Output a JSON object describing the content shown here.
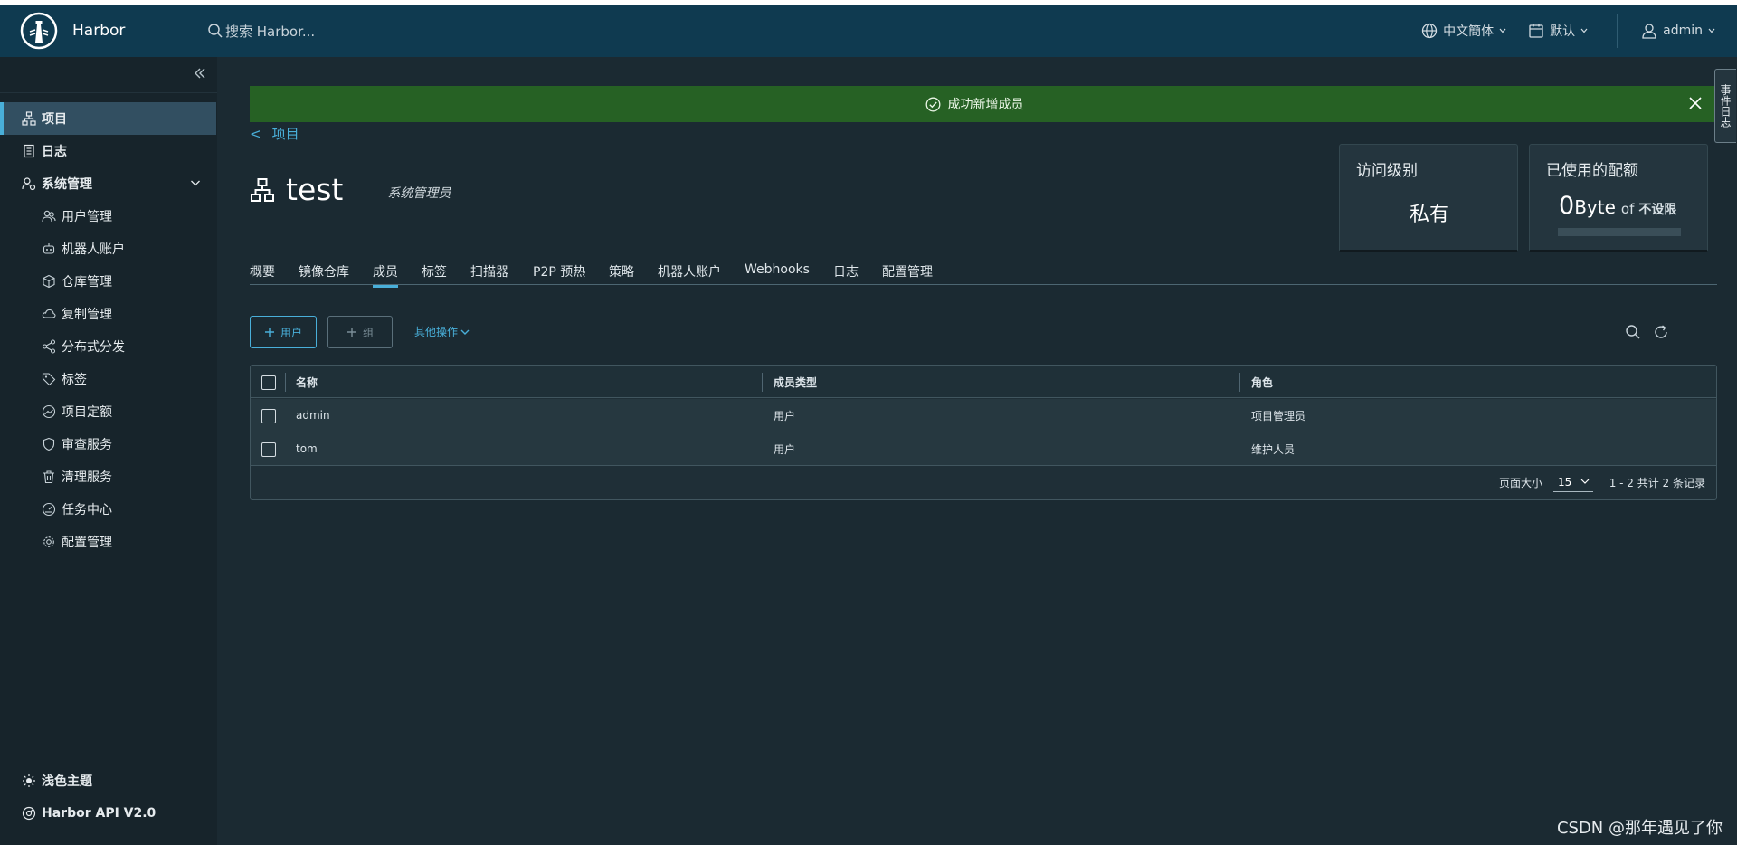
{
  "header": {
    "app_name": "Harbor",
    "search_placeholder": "搜索 Harbor...",
    "language": "中文簡体",
    "theme_mode": "默认",
    "user": "admin"
  },
  "sidebar": {
    "items": [
      {
        "label": "项目",
        "icon": "projects-icon",
        "level": "top",
        "active": true
      },
      {
        "label": "日志",
        "icon": "logs-icon",
        "level": "top"
      },
      {
        "label": "系统管理",
        "icon": "admin-icon",
        "level": "top",
        "expanded": true
      },
      {
        "label": "用户管理",
        "icon": "users-icon",
        "level": "sub"
      },
      {
        "label": "机器人账户",
        "icon": "robot-icon",
        "level": "sub"
      },
      {
        "label": "仓库管理",
        "icon": "registry-icon",
        "level": "sub"
      },
      {
        "label": "复制管理",
        "icon": "replication-icon",
        "level": "sub"
      },
      {
        "label": "分布式分发",
        "icon": "distribution-icon",
        "level": "sub"
      },
      {
        "label": "标签",
        "icon": "tag-icon",
        "level": "sub"
      },
      {
        "label": "项目定额",
        "icon": "quota-icon",
        "level": "sub"
      },
      {
        "label": "审查服务",
        "icon": "shield-icon",
        "level": "sub"
      },
      {
        "label": "清理服务",
        "icon": "trash-icon",
        "level": "sub"
      },
      {
        "label": "任务中心",
        "icon": "dashboard-icon",
        "level": "sub"
      },
      {
        "label": "配置管理",
        "icon": "gear-icon",
        "level": "sub"
      }
    ],
    "bottom": [
      {
        "label": "浅色主题",
        "icon": "sun-icon"
      },
      {
        "label": "Harbor API V2.0",
        "icon": "api-icon"
      }
    ]
  },
  "alert": {
    "message": "成功新增成员",
    "color": "#266124"
  },
  "breadcrumb": {
    "arrow": "<",
    "label": "项目"
  },
  "project": {
    "name": "test",
    "role": "系统管理员"
  },
  "cards": {
    "access": {
      "title": "访问级别",
      "value": "私有"
    },
    "quota": {
      "title": "已使用的配额",
      "used_num": "0",
      "used_unit": "Byte",
      "of": "of",
      "limit": "不设限",
      "used_fraction": 0
    }
  },
  "tabs": [
    {
      "label": "概要"
    },
    {
      "label": "镜像仓库"
    },
    {
      "label": "成员",
      "active": true
    },
    {
      "label": "标签"
    },
    {
      "label": "扫描器"
    },
    {
      "label": "P2P 预热"
    },
    {
      "label": "策略"
    },
    {
      "label": "机器人账户"
    },
    {
      "label": "Webhooks"
    },
    {
      "label": "日志"
    },
    {
      "label": "配置管理"
    }
  ],
  "toolbar": {
    "add_user": "用户",
    "add_group": "组",
    "more_actions": "其他操作"
  },
  "table": {
    "columns": [
      "名称",
      "成员类型",
      "角色"
    ],
    "rows": [
      [
        "admin",
        "用户",
        "项目管理员"
      ],
      [
        "tom",
        "用户",
        "维护人员"
      ]
    ],
    "page_size_label": "页面大小",
    "page_size": "15",
    "range": "1 - 2 共计 2 条记录"
  },
  "side_tab": "事件日志",
  "watermark": "CSDN @那年遇见了你",
  "colors": {
    "accent": "#49afd9",
    "header_bg": "#0f3a50",
    "sidebar_bg": "#17242b",
    "content_bg": "#1b2a32"
  }
}
